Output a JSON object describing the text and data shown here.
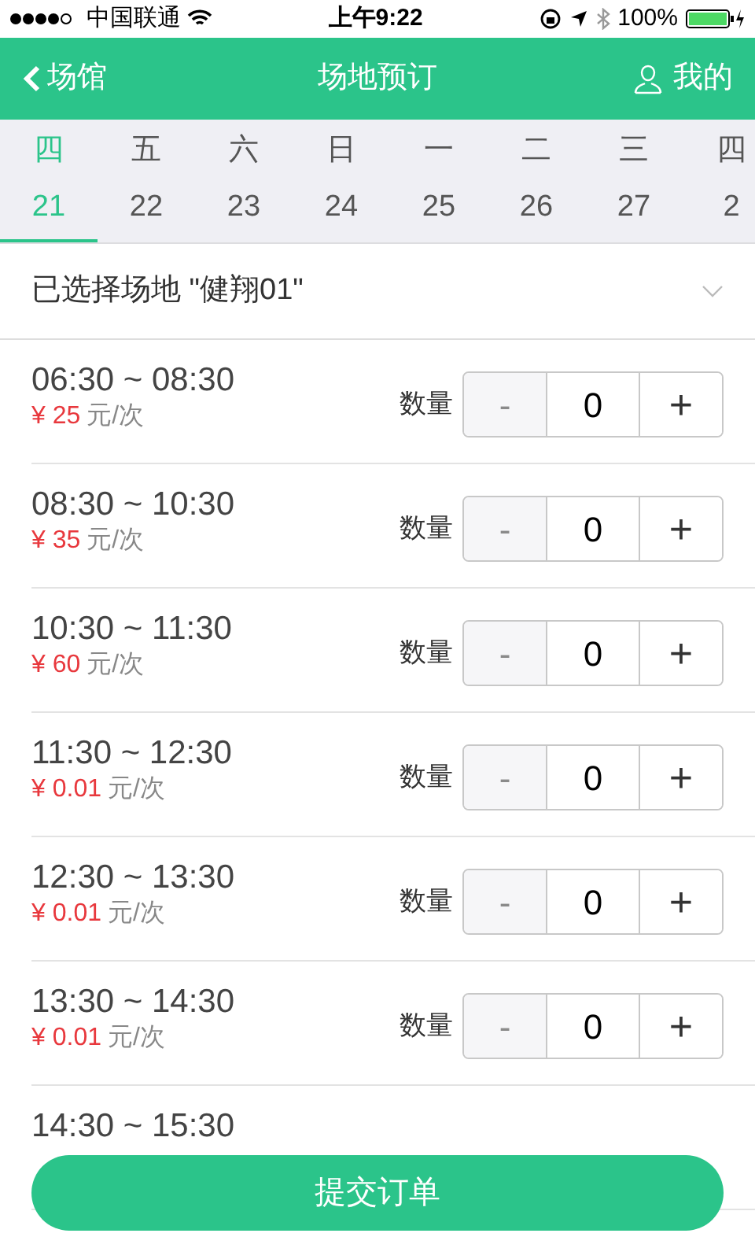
{
  "status_bar": {
    "carrier": "中国联通",
    "time": "上午9:22",
    "battery": "100%"
  },
  "header": {
    "back": "场馆",
    "title": "场地预订",
    "account": "我的"
  },
  "days": [
    {
      "weekday": "四",
      "date": "21",
      "selected": true
    },
    {
      "weekday": "五",
      "date": "22",
      "selected": false
    },
    {
      "weekday": "六",
      "date": "23",
      "selected": false
    },
    {
      "weekday": "日",
      "date": "24",
      "selected": false
    },
    {
      "weekday": "一",
      "date": "25",
      "selected": false
    },
    {
      "weekday": "二",
      "date": "26",
      "selected": false
    },
    {
      "weekday": "三",
      "date": "27",
      "selected": false
    },
    {
      "weekday": "四",
      "date": "2",
      "selected": false
    }
  ],
  "venue_select": {
    "label": "已选择场地 \"健翔01\""
  },
  "slots": [
    {
      "time": "06:30 ~ 08:30",
      "price": "¥ 25",
      "unit": "元/次",
      "quantity_label": "数量",
      "minus": "-",
      "quantity": "0",
      "plus": "+",
      "minus_disabled": true
    },
    {
      "time": "08:30 ~ 10:30",
      "price": "¥ 35",
      "unit": "元/次",
      "quantity_label": "数量",
      "minus": "-",
      "quantity": "0",
      "plus": "+",
      "minus_disabled": true
    },
    {
      "time": "10:30 ~ 11:30",
      "price": "¥ 60",
      "unit": "元/次",
      "quantity_label": "数量",
      "minus": "-",
      "quantity": "0",
      "plus": "+",
      "minus_disabled": true
    },
    {
      "time": "11:30 ~ 12:30",
      "price": "¥ 0.01",
      "unit": "元/次",
      "quantity_label": "数量",
      "minus": "-",
      "quantity": "0",
      "plus": "+",
      "minus_disabled": true
    },
    {
      "time": "12:30 ~ 13:30",
      "price": "¥ 0.01",
      "unit": "元/次",
      "quantity_label": "数量",
      "minus": "-",
      "quantity": "0",
      "plus": "+",
      "minus_disabled": true
    },
    {
      "time": "13:30 ~ 14:30",
      "price": "¥ 0.01",
      "unit": "元/次",
      "quantity_label": "数量",
      "minus": "-",
      "quantity": "0",
      "plus": "+",
      "minus_disabled": true
    },
    {
      "time": "14:30 ~ 15:30"
    }
  ],
  "submit": "提交订单"
}
